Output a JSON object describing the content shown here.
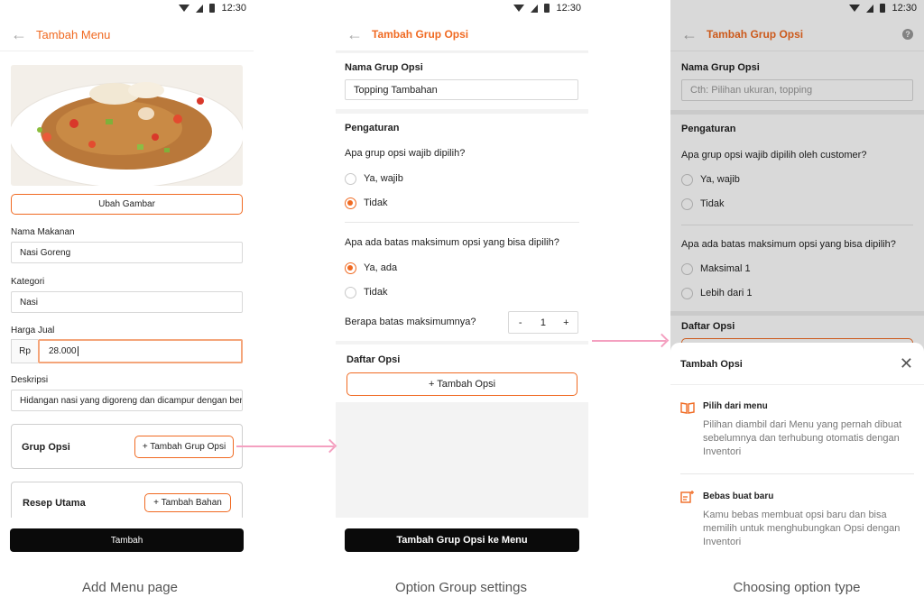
{
  "status_time": "12:30",
  "screen1": {
    "title": "Tambah Menu",
    "change_image": "Ubah Gambar",
    "name_label": "Nama Makanan",
    "name_value": "Nasi Goreng",
    "category_label": "Kategori",
    "category_value": "Nasi",
    "price_label": "Harga Jual",
    "currency": "Rp",
    "price_value": "28.000",
    "desc_label": "Deskripsi",
    "desc_value": "Hidangan nasi yang digoreng dan dicampur dengan berb",
    "group_title": "Grup Opsi",
    "add_group": "+ Tambah Grup Opsi",
    "recipe_title": "Resep Utama",
    "add_ingredient": "+ Tambah Bahan",
    "submit": "Tambah"
  },
  "screen2": {
    "title": "Tambah Grup Opsi",
    "name_label": "Nama Grup Opsi",
    "name_value": "Topping Tambahan",
    "settings_title": "Pengaturan",
    "q1": "Apa grup opsi wajib dipilih?",
    "q1_yes": "Ya, wajib",
    "q1_no": "Tidak",
    "q2": "Apa ada batas maksimum opsi yang bisa dipilih?",
    "q2_yes": "Ya, ada",
    "q2_no": "Tidak",
    "max_label": "Berapa batas maksimumnya?",
    "minus": "-",
    "max_value": "1",
    "plus": "+",
    "list_title": "Daftar Opsi",
    "add_option": "+ Tambah Opsi",
    "submit": "Tambah Grup Opsi ke Menu"
  },
  "screen3": {
    "title": "Tambah Grup Opsi",
    "help": "?",
    "name_label": "Nama Grup Opsi",
    "name_placeholder": "Cth: Pilihan ukuran, topping",
    "settings_title": "Pengaturan",
    "q1": "Apa grup opsi wajib dipilih oleh customer?",
    "q1_yes": "Ya, wajib",
    "q1_no": "Tidak",
    "q2": "Apa ada batas maksimum opsi yang bisa dipilih?",
    "q2_a": "Maksimal 1",
    "q2_b": "Lebih dari 1",
    "list_title": "Daftar Opsi",
    "sheet_title": "Tambah Opsi",
    "opt1_title": "Pilih dari menu",
    "opt1_desc": "Pilihan diambil dari Menu yang pernah dibuat sebelumnya dan terhubung otomatis dengan Inventori",
    "opt2_title": "Bebas buat baru",
    "opt2_desc": "Kamu bebas membuat opsi baru dan bisa memilih untuk menghubungkan Opsi dengan Inventori"
  },
  "captions": {
    "c1": "Add Menu page",
    "c2": "Option Group settings",
    "c3": "Choosing option type"
  },
  "colors": {
    "accent": "#f06a22",
    "arrow": "#f4a0c0",
    "button": "#0a0a0a"
  }
}
